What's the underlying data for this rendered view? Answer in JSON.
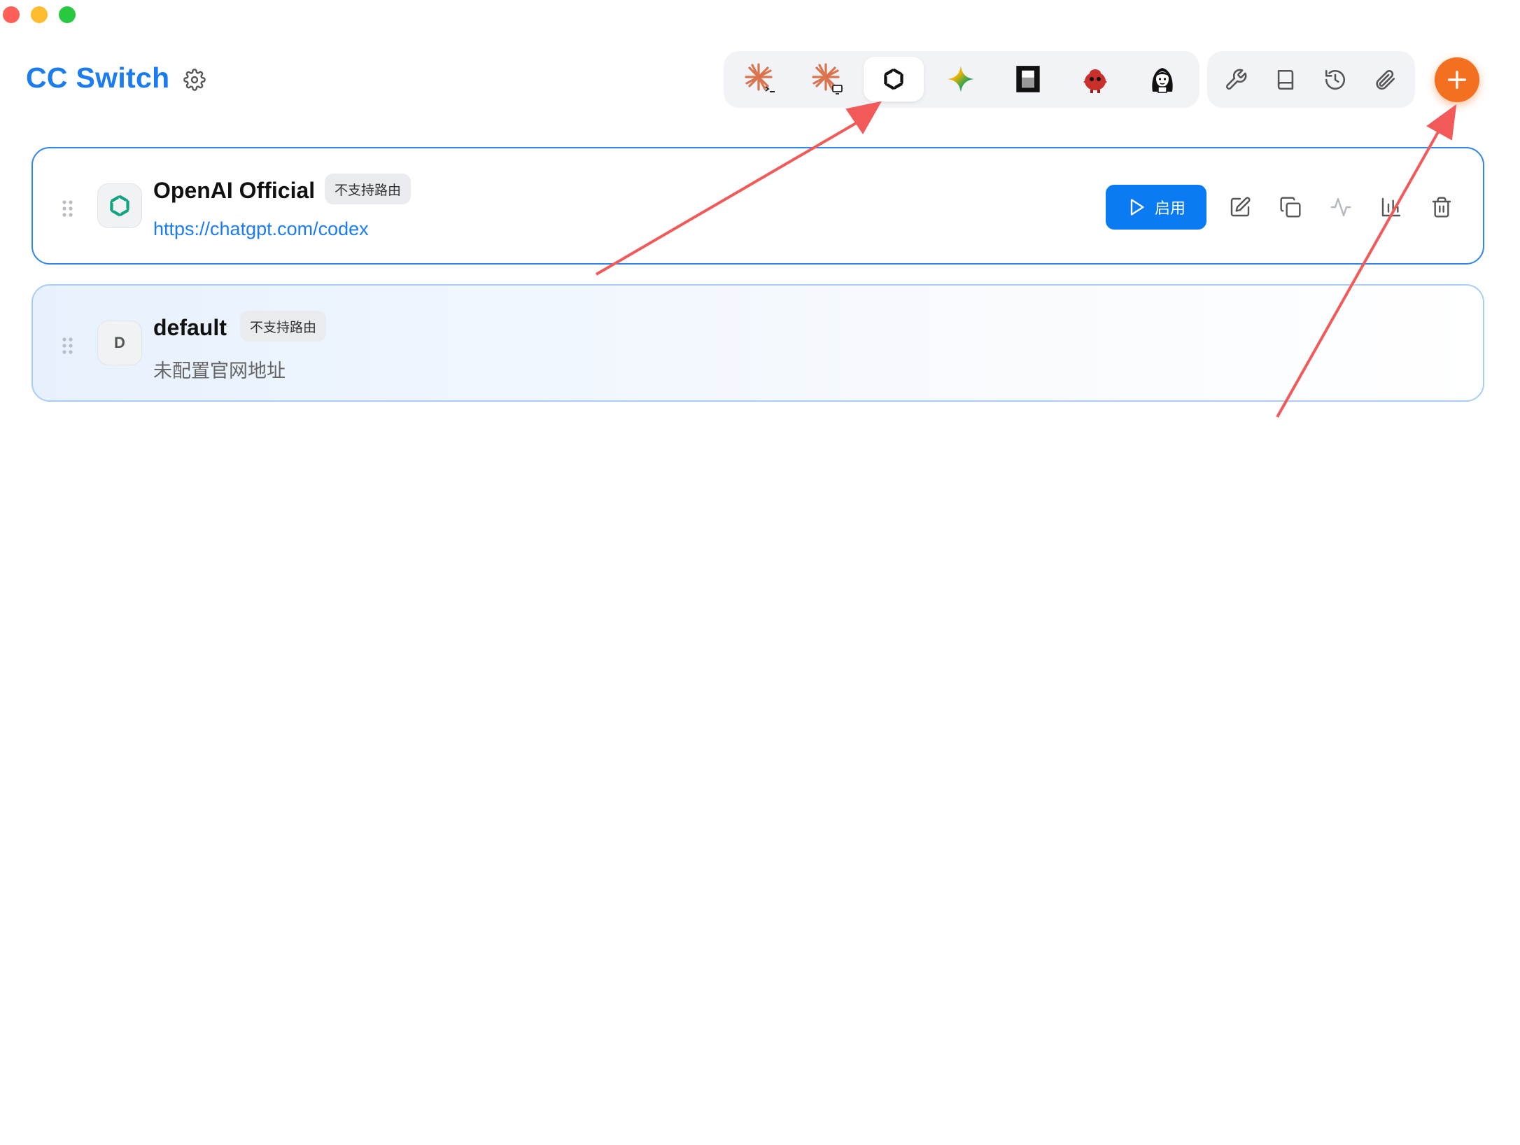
{
  "window": {
    "title": "CC Switch"
  },
  "header": {
    "settings_icon": "gear-icon",
    "apps": [
      {
        "id": "claude-code",
        "icon": "claude-terminal-icon",
        "active": false
      },
      {
        "id": "claude-desktop",
        "icon": "claude-desktop-icon",
        "active": false
      },
      {
        "id": "codex",
        "icon": "openai-icon",
        "active": true
      },
      {
        "id": "gemini",
        "icon": "gemini-icon",
        "active": false
      },
      {
        "id": "opencode",
        "icon": "opencode-icon",
        "active": false
      },
      {
        "id": "app-red",
        "icon": "red-mascot-icon",
        "active": false
      },
      {
        "id": "app-face",
        "icon": "portrait-icon",
        "active": false
      }
    ],
    "tools": [
      {
        "id": "tools",
        "icon": "wrench-icon"
      },
      {
        "id": "prompts",
        "icon": "book-icon"
      },
      {
        "id": "history",
        "icon": "history-icon"
      },
      {
        "id": "attachments",
        "icon": "paperclip-icon"
      }
    ],
    "add_icon": "plus-icon",
    "add_color": "#f37021"
  },
  "providers": [
    {
      "name": "OpenAI Official",
      "badge": "不支持路由",
      "url": "https://chatgpt.com/codex",
      "logo": "openai-icon",
      "enable_label": "启用"
    },
    {
      "name": "default",
      "badge": "不支持路由",
      "url": "未配置官网地址",
      "logo_letter": "D"
    }
  ],
  "colors": {
    "accent": "#1a7cf0",
    "button_primary": "#0a7bf2",
    "annotation_arrow": "#f25a5a"
  }
}
